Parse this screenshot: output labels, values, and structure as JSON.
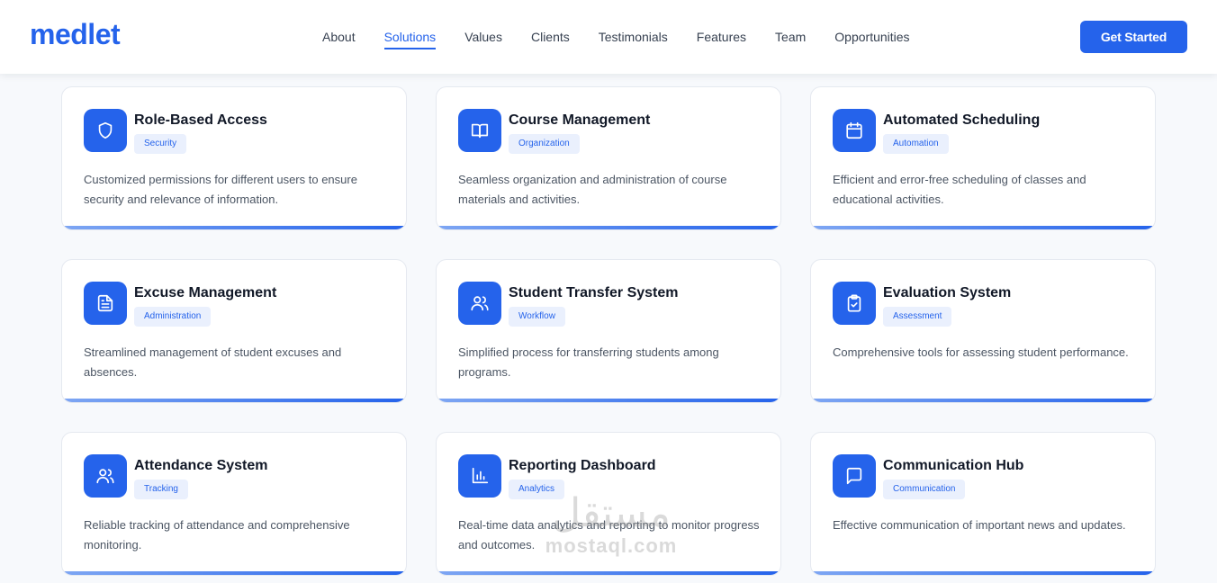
{
  "header": {
    "logo": "medlet",
    "nav": [
      "About",
      "Solutions",
      "Values",
      "Clients",
      "Testimonials",
      "Features",
      "Team",
      "Opportunities"
    ],
    "active_nav": "Solutions",
    "cta_label": "Get Started"
  },
  "colors": {
    "accent": "#2563eb",
    "badge_bg": "#eaf0fd",
    "page_bg": "#f7f9fc"
  },
  "cards": [
    {
      "title": "Role-Based Access",
      "badge": "Security",
      "icon": "shield-icon",
      "desc": "Customized permissions for different users to ensure security and relevance of information."
    },
    {
      "title": "Course Management",
      "badge": "Organization",
      "icon": "book-open-icon",
      "desc": "Seamless organization and administration of course materials and activities."
    },
    {
      "title": "Automated Scheduling",
      "badge": "Automation",
      "icon": "calendar-icon",
      "desc": "Efficient and error-free scheduling of classes and educational activities."
    },
    {
      "title": "Excuse Management",
      "badge": "Administration",
      "icon": "document-icon",
      "desc": "Streamlined management of student excuses and absences."
    },
    {
      "title": "Student Transfer System",
      "badge": "Workflow",
      "icon": "users-icon",
      "desc": "Simplified process for transferring students among programs."
    },
    {
      "title": "Evaluation System",
      "badge": "Assessment",
      "icon": "clipboard-check-icon",
      "desc": "Comprehensive tools for assessing student performance."
    },
    {
      "title": "Attendance System",
      "badge": "Tracking",
      "icon": "users-icon",
      "desc": "Reliable tracking of attendance and comprehensive monitoring."
    },
    {
      "title": "Reporting Dashboard",
      "badge": "Analytics",
      "icon": "bar-chart-icon",
      "desc": "Real-time data analytics and reporting to monitor progress and outcomes."
    },
    {
      "title": "Communication Hub",
      "badge": "Communication",
      "icon": "message-square-icon",
      "desc": "Effective communication of important news and updates."
    }
  ],
  "watermark": {
    "arabic": "مستقل",
    "latin": "mostaql.com"
  }
}
